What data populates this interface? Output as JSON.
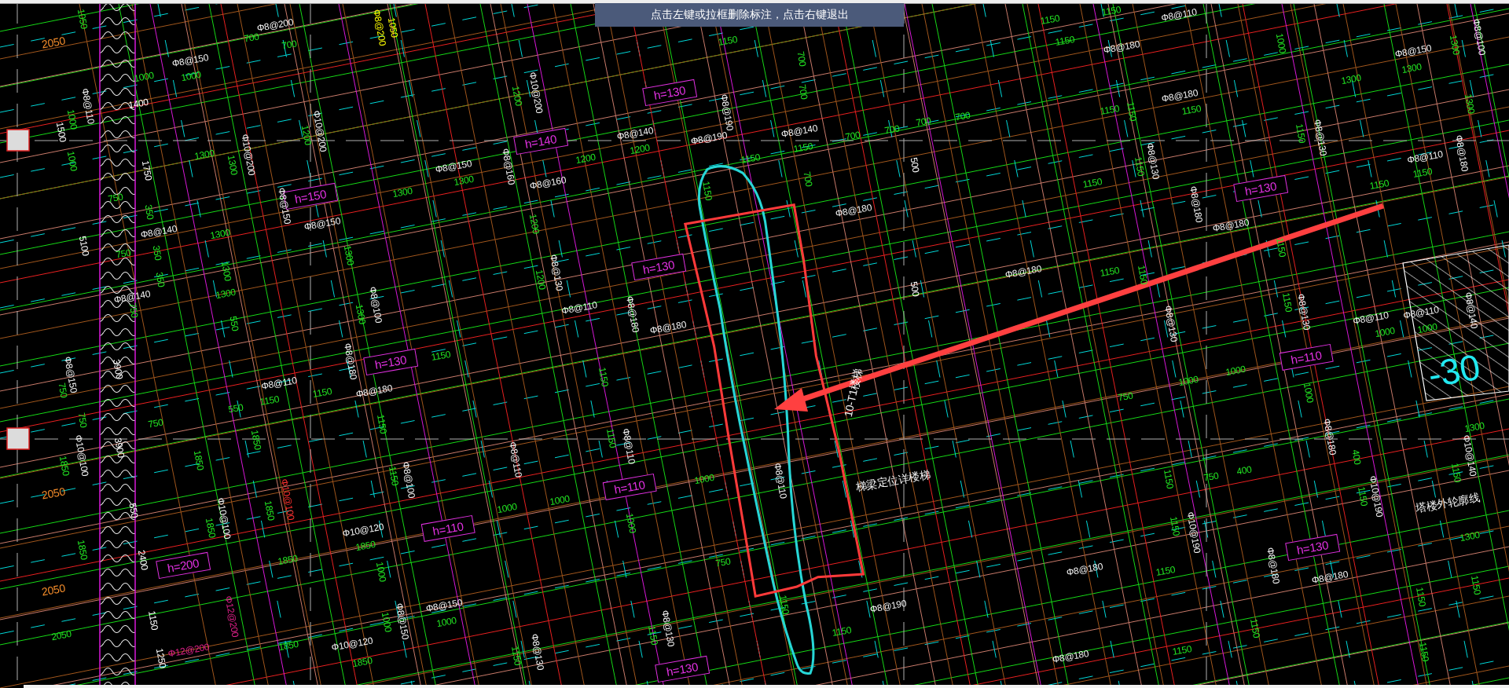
{
  "status_tip": "点击左键或拉框删除标注，点击右键退出",
  "drawing": {
    "labels": [
      {
        "text": "2050",
        "kind": "axis"
      },
      {
        "text": "1050",
        "kind": "dim"
      },
      {
        "text": "Φ8@150",
        "kind": "rebar"
      },
      {
        "text": "1000",
        "kind": "dim"
      },
      {
        "text": "1000",
        "kind": "dim"
      },
      {
        "text": "Φ8@200",
        "kind": "rebar"
      },
      {
        "text": "700",
        "kind": "dim"
      },
      {
        "text": "700",
        "kind": "dim"
      },
      {
        "text": "Φ8@200",
        "kind": "rebar",
        "color": "#ffff00"
      },
      {
        "text": "1050",
        "kind": "dim",
        "color": "#ffff00"
      },
      {
        "text": "1500",
        "kind": "dim",
        "color": "#ffffff"
      },
      {
        "text": "1000",
        "kind": "dim"
      },
      {
        "text": "Φ8@110",
        "kind": "rebar"
      },
      {
        "text": "1400",
        "kind": "dim",
        "color": "#ffffff"
      },
      {
        "text": "1000",
        "kind": "dim"
      },
      {
        "text": "1750",
        "kind": "dim",
        "color": "#ffffff"
      },
      {
        "text": "750",
        "kind": "dim"
      },
      {
        "text": "350",
        "kind": "dim"
      },
      {
        "text": "Φ8@140",
        "kind": "rebar"
      },
      {
        "text": "750",
        "kind": "dim"
      },
      {
        "text": "350",
        "kind": "dim"
      },
      {
        "text": "350",
        "kind": "dim"
      },
      {
        "text": "1300",
        "kind": "dim"
      },
      {
        "text": "1300",
        "kind": "dim"
      },
      {
        "text": "Φ10@200",
        "kind": "rebar"
      },
      {
        "text": "1200",
        "kind": "dim"
      },
      {
        "text": "Φ10@200",
        "kind": "rebar"
      },
      {
        "text": "h=150",
        "kind": "slab"
      },
      {
        "text": "Φ8@150",
        "kind": "rebar"
      },
      {
        "text": "Φ8@150",
        "kind": "rebar"
      },
      {
        "text": "1300",
        "kind": "dim"
      },
      {
        "text": "1300",
        "kind": "dim"
      },
      {
        "text": "1300",
        "kind": "dim"
      },
      {
        "text": "Φ8@140",
        "kind": "rebar"
      },
      {
        "text": "750",
        "kind": "dim"
      },
      {
        "text": "5100",
        "kind": "dim",
        "color": "#ffffff"
      },
      {
        "text": "Φ8@150",
        "kind": "rebar"
      },
      {
        "text": "1300",
        "kind": "dim"
      },
      {
        "text": "1300",
        "kind": "dim"
      },
      {
        "text": "1300",
        "kind": "dim"
      },
      {
        "text": "Φ8@100",
        "kind": "rebar"
      },
      {
        "text": "1300",
        "kind": "dim"
      },
      {
        "text": "550",
        "kind": "dim"
      },
      {
        "text": "1200",
        "kind": "dim"
      },
      {
        "text": "Φ10@200",
        "kind": "rebar"
      },
      {
        "text": "h=130",
        "kind": "slab"
      },
      {
        "text": "h=140",
        "kind": "slab"
      },
      {
        "text": "Φ8@190",
        "kind": "rebar"
      },
      {
        "text": "Φ8@140",
        "kind": "rebar"
      },
      {
        "text": "1200",
        "kind": "dim"
      },
      {
        "text": "1200",
        "kind": "dim"
      },
      {
        "text": "Φ8@190",
        "kind": "rebar"
      },
      {
        "text": "Φ8@140",
        "kind": "rebar"
      },
      {
        "text": "1150",
        "kind": "dim"
      },
      {
        "text": "1150",
        "kind": "dim"
      },
      {
        "text": "1150",
        "kind": "dim"
      },
      {
        "text": "700",
        "kind": "dim"
      },
      {
        "text": "700",
        "kind": "dim"
      },
      {
        "text": "700",
        "kind": "dim"
      },
      {
        "text": "700",
        "kind": "dim"
      },
      {
        "text": "700",
        "kind": "dim"
      },
      {
        "text": "700",
        "kind": "dim"
      },
      {
        "text": "Φ8@160",
        "kind": "rebar"
      },
      {
        "text": "Φ8@160",
        "kind": "rebar"
      },
      {
        "text": "1200",
        "kind": "dim"
      },
      {
        "text": "1150",
        "kind": "dim"
      },
      {
        "text": "700",
        "kind": "dim"
      },
      {
        "text": "Φ8@180",
        "kind": "rebar"
      },
      {
        "text": "500",
        "kind": "dim",
        "color": "#ffffff"
      },
      {
        "text": "500",
        "kind": "dim",
        "color": "#ffffff"
      },
      {
        "text": "h=130",
        "kind": "slab"
      },
      {
        "text": "1200",
        "kind": "dim"
      },
      {
        "text": "Φ8@130",
        "kind": "rebar"
      },
      {
        "text": "Φ8@110",
        "kind": "rebar"
      },
      {
        "text": "Φ8@180",
        "kind": "rebar"
      },
      {
        "text": "Φ8@180",
        "kind": "rebar"
      },
      {
        "text": "1150",
        "kind": "dim"
      },
      {
        "text": "1150",
        "kind": "dim"
      },
      {
        "text": "Φ8@110",
        "kind": "rebar"
      },
      {
        "text": "1000",
        "kind": "dim"
      },
      {
        "text": "Φ8@100",
        "kind": "rebar"
      },
      {
        "text": "1300",
        "kind": "dim"
      },
      {
        "text": "1150",
        "kind": "dim"
      },
      {
        "text": "Φ8@180",
        "kind": "rebar"
      },
      {
        "text": "Φ8@150",
        "kind": "rebar"
      },
      {
        "text": "1300",
        "kind": "dim"
      },
      {
        "text": "1300",
        "kind": "dim"
      },
      {
        "text": "Φ8@180",
        "kind": "rebar"
      },
      {
        "text": "1150",
        "kind": "dim"
      },
      {
        "text": "1150",
        "kind": "dim"
      },
      {
        "text": "1150",
        "kind": "dim"
      },
      {
        "text": "1150",
        "kind": "dim"
      },
      {
        "text": "Φ8@130",
        "kind": "rebar"
      },
      {
        "text": "1300",
        "kind": "dim"
      },
      {
        "text": "Φ8@130",
        "kind": "rebar"
      },
      {
        "text": "1150",
        "kind": "dim"
      },
      {
        "text": "1150",
        "kind": "dim"
      },
      {
        "text": "Φ8@180",
        "kind": "rebar"
      },
      {
        "text": "h=130",
        "kind": "slab"
      },
      {
        "text": "Φ8@110",
        "kind": "rebar"
      },
      {
        "text": "1150",
        "kind": "dim"
      },
      {
        "text": "1150",
        "kind": "dim"
      },
      {
        "text": "Φ8@180",
        "kind": "rebar"
      },
      {
        "text": "Φ8@180",
        "kind": "rebar"
      },
      {
        "text": "1150",
        "kind": "dim"
      },
      {
        "text": "Φ8@180",
        "kind": "rebar"
      },
      {
        "text": "1150",
        "kind": "dim"
      },
      {
        "text": "1150",
        "kind": "dim"
      },
      {
        "text": "Φ8@130",
        "kind": "rebar"
      },
      {
        "text": "1150",
        "kind": "dim"
      },
      {
        "text": "Φ8@110",
        "kind": "rebar"
      },
      {
        "text": "Φ8@110",
        "kind": "rebar"
      },
      {
        "text": "1000",
        "kind": "dim"
      },
      {
        "text": "1000",
        "kind": "dim"
      },
      {
        "text": "Φ8@140",
        "kind": "rebar"
      },
      {
        "text": "Φ8@130",
        "kind": "rebar"
      },
      {
        "text": "-30",
        "kind": "level"
      },
      {
        "text": "Φ8@150",
        "kind": "rebar"
      },
      {
        "text": "750",
        "kind": "dim"
      },
      {
        "text": "750",
        "kind": "dim"
      },
      {
        "text": "Φ10@100",
        "kind": "rebar"
      },
      {
        "text": "1850",
        "kind": "dim"
      },
      {
        "text": "2050",
        "kind": "axis"
      },
      {
        "text": "3900",
        "kind": "dim",
        "color": "#ffffff"
      },
      {
        "text": "3900",
        "kind": "dim",
        "color": "#ffffff"
      },
      {
        "text": "550",
        "kind": "dim",
        "color": "#ffffff"
      },
      {
        "text": "1850",
        "kind": "dim"
      },
      {
        "text": "2050",
        "kind": "axis"
      },
      {
        "text": "2400",
        "kind": "dim",
        "color": "#ffffff"
      },
      {
        "text": "h=200",
        "kind": "slab"
      },
      {
        "text": "2050",
        "kind": "dim"
      },
      {
        "text": "1150",
        "kind": "dim",
        "color": "#ffffff"
      },
      {
        "text": "1250",
        "kind": "dim",
        "color": "#ffffff"
      },
      {
        "text": "Φ12@200",
        "kind": "rebar",
        "color": "#e0208a"
      },
      {
        "text": "Φ12@200",
        "kind": "rebar",
        "color": "#e0208a"
      },
      {
        "text": "750",
        "kind": "dim"
      },
      {
        "text": "1850",
        "kind": "dim"
      },
      {
        "text": "Φ10@100",
        "kind": "rebar"
      },
      {
        "text": "1850",
        "kind": "dim"
      },
      {
        "text": "550",
        "kind": "dim"
      },
      {
        "text": "1150",
        "kind": "dim"
      },
      {
        "text": "Φ8@110",
        "kind": "rebar"
      },
      {
        "text": "1150",
        "kind": "dim"
      },
      {
        "text": "1850",
        "kind": "dim"
      },
      {
        "text": "1850",
        "kind": "dim"
      },
      {
        "text": "Φ10@100",
        "kind": "rebar",
        "color": "#ff3030"
      },
      {
        "text": "1850",
        "kind": "dim"
      },
      {
        "text": "Φ10@120",
        "kind": "rebar"
      },
      {
        "text": "1850",
        "kind": "dim"
      },
      {
        "text": "1000",
        "kind": "dim"
      },
      {
        "text": "1850",
        "kind": "dim"
      },
      {
        "text": "Φ10@120",
        "kind": "rebar"
      },
      {
        "text": "1850",
        "kind": "dim"
      },
      {
        "text": "Φ8@180",
        "kind": "rebar"
      },
      {
        "text": "Φ8@180",
        "kind": "rebar"
      },
      {
        "text": "h=130",
        "kind": "slab"
      },
      {
        "text": "1150",
        "kind": "dim"
      },
      {
        "text": "1150",
        "kind": "dim"
      },
      {
        "text": "Φ8@100",
        "kind": "rebar"
      },
      {
        "text": "1150",
        "kind": "dim"
      },
      {
        "text": "h=110",
        "kind": "slab"
      },
      {
        "text": "Φ8@150",
        "kind": "rebar"
      },
      {
        "text": "1000",
        "kind": "dim"
      },
      {
        "text": "Φ8@150",
        "kind": "rebar"
      },
      {
        "text": "1000",
        "kind": "dim"
      },
      {
        "text": "1150",
        "kind": "dim"
      },
      {
        "text": "Φ8@110",
        "kind": "rebar"
      },
      {
        "text": "1150",
        "kind": "dim"
      },
      {
        "text": "Φ8@110",
        "kind": "rebar"
      },
      {
        "text": "h=110",
        "kind": "slab"
      },
      {
        "text": "1000",
        "kind": "dim"
      },
      {
        "text": "1000",
        "kind": "dim"
      },
      {
        "text": "1000",
        "kind": "dim"
      },
      {
        "text": "1000",
        "kind": "dim"
      },
      {
        "text": "Φ8@110",
        "kind": "rebar"
      },
      {
        "text": "10-T1楼梯",
        "kind": "note"
      },
      {
        "text": "梯梁定位详楼梯",
        "kind": "note"
      },
      {
        "text": "750",
        "kind": "dim"
      },
      {
        "text": "1150",
        "kind": "dim"
      },
      {
        "text": "Φ8@190",
        "kind": "rebar"
      },
      {
        "text": "1150",
        "kind": "dim"
      },
      {
        "text": "Φ8@130",
        "kind": "rebar"
      },
      {
        "text": "1150",
        "kind": "dim"
      },
      {
        "text": "Φ8@130",
        "kind": "rebar"
      },
      {
        "text": "1150",
        "kind": "dim"
      },
      {
        "text": "h=130",
        "kind": "slab"
      },
      {
        "text": "h=110",
        "kind": "slab"
      },
      {
        "text": "1000",
        "kind": "dim"
      },
      {
        "text": "1000",
        "kind": "dim"
      },
      {
        "text": "750",
        "kind": "dim"
      },
      {
        "text": "1000",
        "kind": "dim"
      },
      {
        "text": "Φ8@180",
        "kind": "rebar"
      },
      {
        "text": "400",
        "kind": "dim"
      },
      {
        "text": "750",
        "kind": "dim"
      },
      {
        "text": "400",
        "kind": "dim"
      },
      {
        "text": "1150",
        "kind": "dim"
      },
      {
        "text": "Φ10@190",
        "kind": "rebar"
      },
      {
        "text": "1150",
        "kind": "dim"
      },
      {
        "text": "Φ10@190",
        "kind": "rebar"
      },
      {
        "text": "1150",
        "kind": "dim"
      },
      {
        "text": "塔楼外轮廓线",
        "kind": "note"
      },
      {
        "text": "1300",
        "kind": "dim"
      },
      {
        "text": "Φ10@140",
        "kind": "rebar"
      },
      {
        "text": "1150",
        "kind": "dim"
      },
      {
        "text": "1300",
        "kind": "dim"
      },
      {
        "text": "h=130",
        "kind": "slab"
      },
      {
        "text": "Φ8@180",
        "kind": "rebar"
      },
      {
        "text": "Φ8@180",
        "kind": "rebar"
      },
      {
        "text": "Φ8@180",
        "kind": "rebar"
      },
      {
        "text": "1150",
        "kind": "dim"
      },
      {
        "text": "1150",
        "kind": "dim"
      },
      {
        "text": "1150",
        "kind": "dim"
      },
      {
        "text": "1150",
        "kind": "dim"
      },
      {
        "text": "Φ8@180",
        "kind": "rebar"
      },
      {
        "text": "1150",
        "kind": "dim"
      },
      {
        "text": "1150",
        "kind": "dim"
      }
    ]
  }
}
